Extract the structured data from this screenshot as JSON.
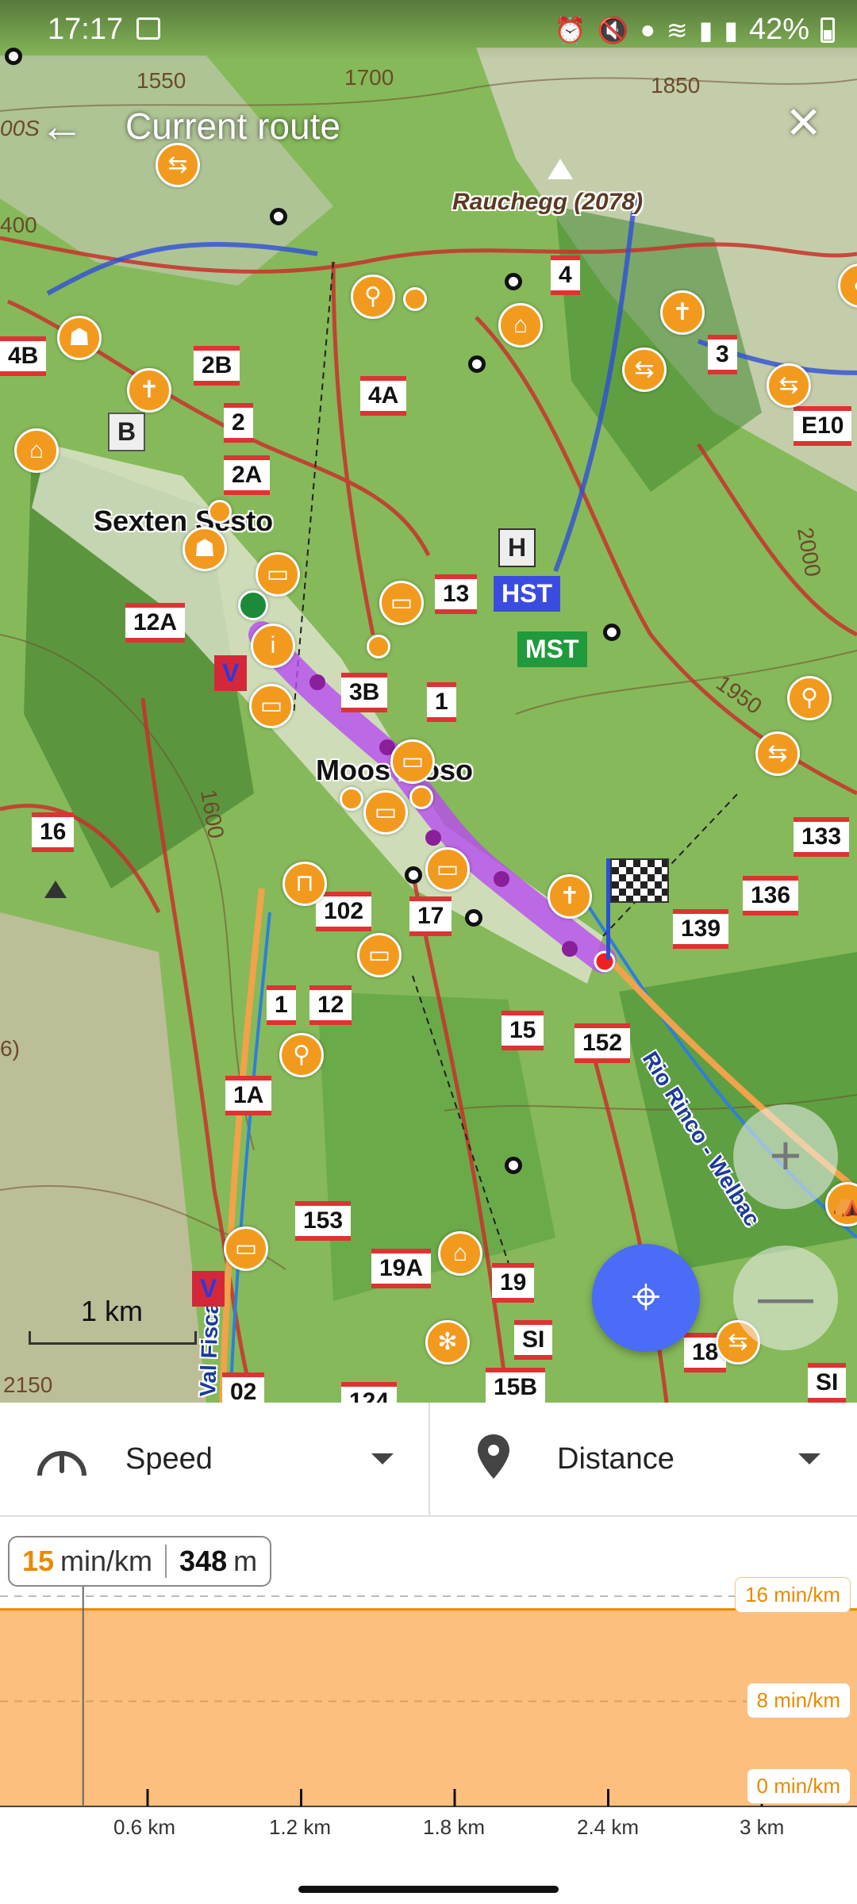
{
  "status_bar": {
    "time": "17:17",
    "battery": "42%",
    "icons": [
      "image-icon",
      "alarm-icon",
      "mute-icon",
      "location-icon",
      "wifi-icon",
      "signal-icon",
      "signal-icon"
    ]
  },
  "header": {
    "title": "Current route",
    "back_icon": "arrow-left-icon",
    "close_icon": "close-icon"
  },
  "map": {
    "places": {
      "village_1": "Sexten",
      "village_1b": "Sesto",
      "village_2": "Moos",
      "village_2b": "Moso",
      "peak": "Rauchegg (2078)",
      "river": "Rio Rinco - Welbac",
      "valley": "Val Fisca"
    },
    "contours": [
      "1550",
      "1700",
      "1850",
      "1600",
      "1950",
      "2000",
      "2150",
      "400",
      "6)",
      "00S"
    ],
    "trail_numbers": [
      "4",
      "2B",
      "4A",
      "2",
      "2A",
      "4B",
      "3",
      "E10",
      "13",
      "12A",
      "3B",
      "1",
      "16",
      "102",
      "17",
      "139",
      "136",
      "133",
      "12",
      "1",
      "15",
      "152",
      "1A",
      "153",
      "19A",
      "19",
      "124",
      "15B",
      "02",
      "SI",
      "SI",
      "18"
    ],
    "badges": {
      "hst": "HST",
      "mst": "MST",
      "h": "H",
      "b": "B",
      "v": "V"
    },
    "scale_label": "1 km",
    "route_color": "#b84cf0",
    "accent_color": "#f29a1e"
  },
  "controls": {
    "locate_icon": "crosshair-icon",
    "zoom_in": "+",
    "zoom_out": "—"
  },
  "selectors": {
    "left": {
      "icon": "speedometer-icon",
      "label": "Speed"
    },
    "right": {
      "icon": "location-pin-icon",
      "label": "Distance"
    }
  },
  "readout": {
    "pace_value": "15",
    "pace_unit": "min/km",
    "distance_value": "348",
    "distance_unit": "m"
  },
  "chart_data": {
    "type": "area",
    "y_labels": [
      "16 min/km",
      "8 min/km",
      "0 min/km"
    ],
    "x_labels": [
      "0.6 km",
      "1.2 km",
      "1.8 km",
      "2.4 km",
      "3 km"
    ],
    "ylim": [
      0,
      16
    ],
    "series": [
      {
        "x": [
          0,
          3.3
        ],
        "values": [
          15,
          15
        ]
      }
    ]
  }
}
